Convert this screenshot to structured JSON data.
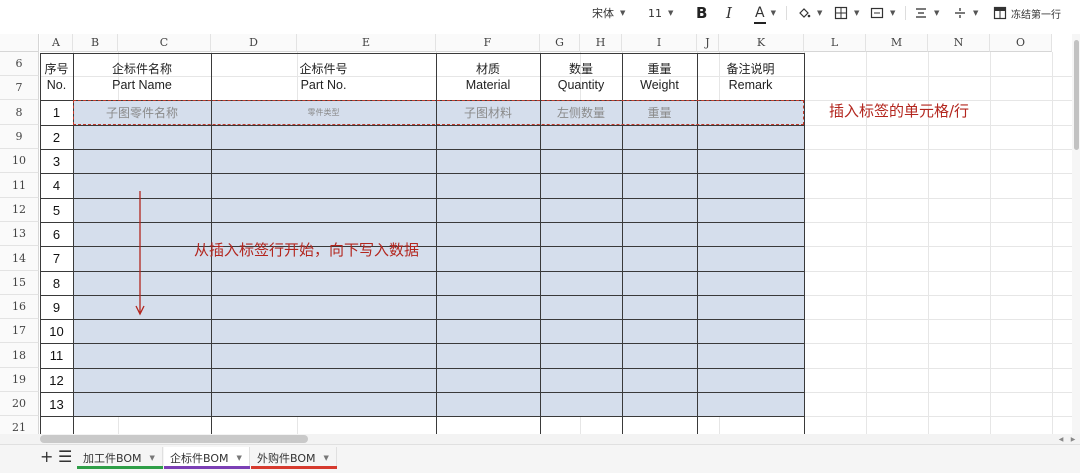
{
  "toolbar": {
    "font_name": "宋体",
    "font_size": "11",
    "bold": "B",
    "italic": "I",
    "font_color": "A",
    "freeze": "冻结第一行"
  },
  "sheet": {
    "columns": [
      "A",
      "B",
      "C",
      "D",
      "E",
      "F",
      "G",
      "H",
      "I",
      "J",
      "K",
      "L",
      "M",
      "N",
      "O"
    ],
    "rows": [
      "6",
      "7",
      "8",
      "9",
      "10",
      "11",
      "12",
      "13",
      "14",
      "15",
      "16",
      "17",
      "18",
      "19",
      "20",
      "21"
    ],
    "headers": {
      "seq_zh": "序号",
      "seq_en": "No.",
      "name_zh": "企标件名称",
      "name_en": "Part Name",
      "partno_zh": "企标件号",
      "partno_en": "Part No.",
      "material_zh": "材质",
      "material_en": "Material",
      "qty_zh": "数量",
      "qty_en": "Quantity",
      "weight_zh": "重量",
      "weight_en": "Weight",
      "remark_zh": "备注说明",
      "remark_en": "Remark"
    },
    "numbers": [
      "1",
      "2",
      "3",
      "4",
      "5",
      "6",
      "7",
      "8",
      "9",
      "10",
      "11",
      "12",
      "13"
    ],
    "placeholders": {
      "name": "子图零件名称",
      "partno": "零件类型",
      "material": "子图材料",
      "qty": "左侧数量",
      "weight": "重量"
    }
  },
  "annotations": {
    "label_row": "插入标签的单元格/行",
    "write_down": "从插入标签行开始，向下写入数据"
  },
  "tabs": [
    {
      "label": "加工件BOM",
      "color": "#2e9e47"
    },
    {
      "label": "企标件BOM",
      "color": "#7b3fb5"
    },
    {
      "label": "外购件BOM",
      "color": "#d63a2e"
    }
  ],
  "colors": {
    "shade": "#d5deec",
    "annotation": "#b3261e"
  }
}
